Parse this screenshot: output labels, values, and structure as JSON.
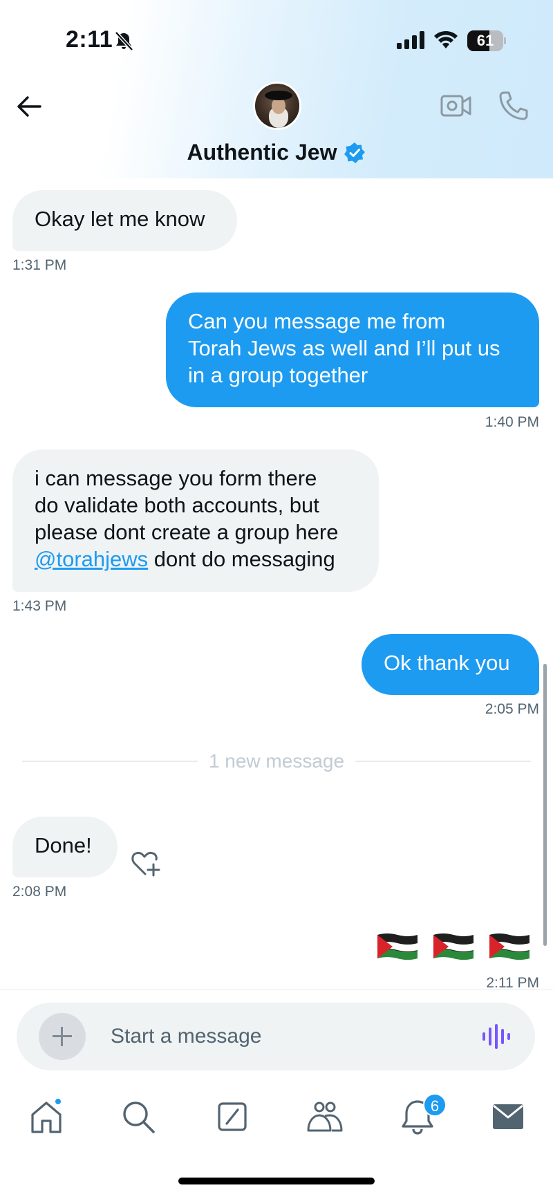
{
  "status_bar": {
    "time": "2:11",
    "battery": "61",
    "battery_level": 0.61
  },
  "header": {
    "contact_name": "Authentic Jew",
    "verified": true,
    "icons": [
      "back-arrow-icon",
      "video-call-icon",
      "phone-call-icon",
      "verified-badge-icon"
    ]
  },
  "messages": [
    {
      "direction": "incoming",
      "lines": [
        "Okay let me know"
      ],
      "time": "1:31 PM"
    },
    {
      "direction": "outgoing",
      "lines": [
        "Can you message me from",
        "Torah Jews as well and I’ll put us",
        "in a group together"
      ],
      "time": "1:40 PM"
    },
    {
      "direction": "incoming",
      "lines": [
        "i can message you form there",
        "do validate both accounts, but",
        "please dont create a group here"
      ],
      "mention": "@torahjews",
      "mention_rest": " dont do messaging",
      "time": "1:43 PM"
    },
    {
      "direction": "outgoing",
      "lines": [
        "Ok thank you"
      ],
      "time": "2:05 PM"
    },
    {
      "direction": "incoming",
      "lines": [
        "Done!"
      ],
      "time": "2:08 PM"
    },
    {
      "direction": "outgoing",
      "emoji": "🇵🇸🇵🇸🇵🇸",
      "time": "2:11 PM"
    }
  ],
  "divider": {
    "label": "1 new message"
  },
  "composer": {
    "placeholder": "Start a message",
    "value": ""
  },
  "tab_bar": {
    "items": [
      "home-icon",
      "search-icon",
      "grok-icon",
      "communities-icon",
      "notifications-icon",
      "messages-icon"
    ],
    "notifications_badge": "6"
  },
  "colors": {
    "accent": "#1d9bf0",
    "incoming_bubble": "#eff3f4",
    "text": "#0f1419",
    "muted": "#536471",
    "voice": "#7856ff"
  }
}
